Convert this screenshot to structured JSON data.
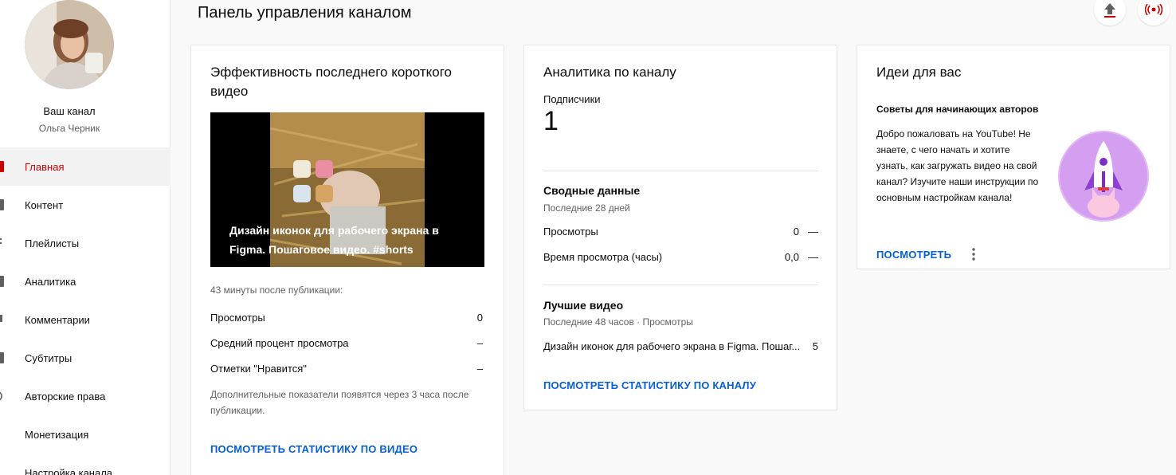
{
  "page": {
    "title": "Панель управления каналом"
  },
  "sidebar": {
    "channel_label": "Ваш канал",
    "channel_owner": "Ольга Черник",
    "items": [
      {
        "label": "Главная",
        "icon": "dashboard-icon",
        "active": true
      },
      {
        "label": "Контент",
        "icon": "content-icon"
      },
      {
        "label": "Плейлисты",
        "icon": "playlists-icon"
      },
      {
        "label": "Аналитика",
        "icon": "analytics-icon"
      },
      {
        "label": "Комментарии",
        "icon": "comments-icon"
      },
      {
        "label": "Субтитры",
        "icon": "subtitles-icon"
      },
      {
        "label": "Авторские права",
        "icon": "copyright-icon"
      },
      {
        "label": "Монетизация",
        "icon": "monetization-icon"
      },
      {
        "label": "Настройка канала",
        "icon": "customization-icon"
      }
    ]
  },
  "header": {
    "upload_icon": "upload-icon",
    "live_icon": "live-icon"
  },
  "short_card": {
    "title": "Эффективность последнего короткого видео",
    "thumbnail_caption": "Дизайн иконок для рабочего экрана в Figma. Пошаговое видео. #shorts",
    "since_label": "43 минуты после публикации:",
    "metrics": [
      {
        "label": "Просмотры",
        "value": "0"
      },
      {
        "label": "Средний процент просмотра",
        "value": "–"
      },
      {
        "label": "Отметки \"Нравится\"",
        "value": "–"
      }
    ],
    "note": "Дополнительные показатели появятся через 3 часа после публикации.",
    "link": "ПОСМОТРЕТЬ СТАТИСТИКУ ПО ВИДЕО"
  },
  "analytics_card": {
    "title": "Аналитика по каналу",
    "subscribers_label": "Подписчики",
    "subscribers_value": "1",
    "summary_title": "Сводные данные",
    "summary_period": "Последние 28 дней",
    "summary_rows": [
      {
        "label": "Просмотры",
        "value": "0",
        "trend": "—"
      },
      {
        "label": "Время просмотра (часы)",
        "value": "0,0",
        "trend": "—"
      }
    ],
    "top_title": "Лучшие видео",
    "top_period": "Последние 48 часов · Просмотры",
    "top_videos": [
      {
        "title": "Дизайн иконок для рабочего экрана в Figma. Пошаг...",
        "value": "5"
      }
    ],
    "link": "ПОСМОТРЕТЬ СТАТИСТИКУ ПО КАНАЛУ"
  },
  "ideas_card": {
    "title": "Идеи для вас",
    "subtitle": "Советы для начинающих авторов",
    "body": "Добро пожаловать на YouTube! Не знаете, с чего начать и хотите узнать, как загружать видео на свой канал? Изучите наши инструкции по основным настройкам канала!",
    "link": "ПОСМОТРЕТЬ",
    "menu_icon": "more-vert-icon",
    "illustration": "rocket-icon"
  }
}
